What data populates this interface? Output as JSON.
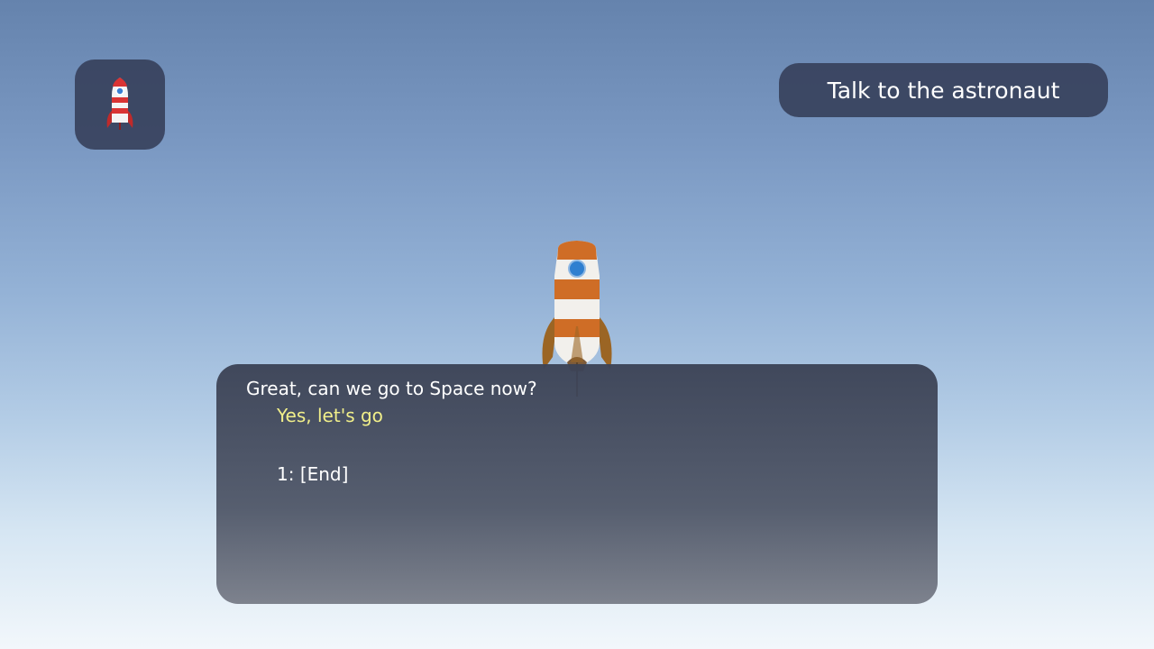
{
  "quest": {
    "title": "Talk to the astronaut"
  },
  "inventory": {
    "item_icon": "rocket-icon"
  },
  "dialogue": {
    "npc_line": "Great, can we go to Space now?",
    "selected_choice": "Yes, let's go",
    "options": [
      "1: [End]"
    ]
  },
  "colors": {
    "panel": "#343e58",
    "highlight": "#f1ef8a",
    "rocket_orange": "#cf6d26",
    "rocket_window": "#2f7fd0"
  }
}
